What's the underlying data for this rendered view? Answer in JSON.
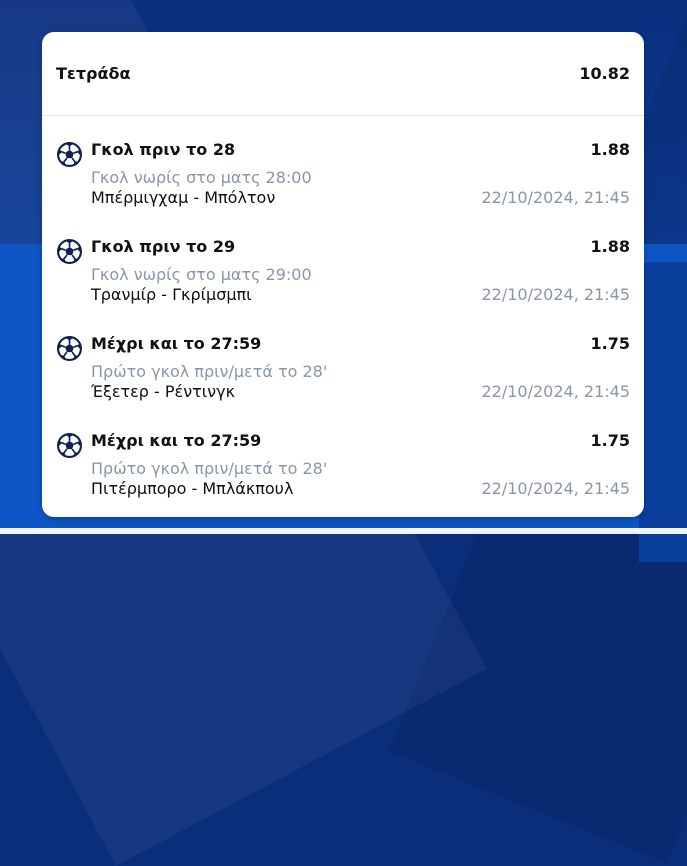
{
  "ticket": {
    "bet_type": "Τετράδα",
    "total_odds": "10.82"
  },
  "selections": [
    {
      "icon": "soccer-ball-icon",
      "name": "Γκολ πριν το 28",
      "odds": "1.88",
      "market": "Γκολ νωρίς στο ματς 28:00",
      "match": "Μπέρμιγχαμ - Μπόλτον",
      "datetime": "22/10/2024, 21:45"
    },
    {
      "icon": "soccer-ball-icon",
      "name": "Γκολ πριν το 29",
      "odds": "1.88",
      "market": "Γκολ νωρίς στο ματς 29:00",
      "match": "Τρανμίρ - Γκρίμσμπι",
      "datetime": "22/10/2024, 21:45"
    },
    {
      "icon": "soccer-ball-icon",
      "name": "Μέχρι και το 27:59",
      "odds": "1.75",
      "market": "Πρώτο γκολ πριν/μετά το 28'",
      "match": "Έξετερ - Ρέντινγκ",
      "datetime": "22/10/2024, 21:45"
    },
    {
      "icon": "soccer-ball-icon",
      "name": "Μέχρι και το 27:59",
      "odds": "1.75",
      "market": "Πρώτο γκολ πριν/μετά το 28'",
      "match": "Πιτέρμπορο - Μπλάκπουλ",
      "datetime": "22/10/2024, 21:45"
    }
  ],
  "colors": {
    "background": "#0c3a93",
    "card": "#ffffff",
    "text_primary": "#111111",
    "text_secondary": "#8a96a8",
    "ball_navy": "#0f2150"
  }
}
